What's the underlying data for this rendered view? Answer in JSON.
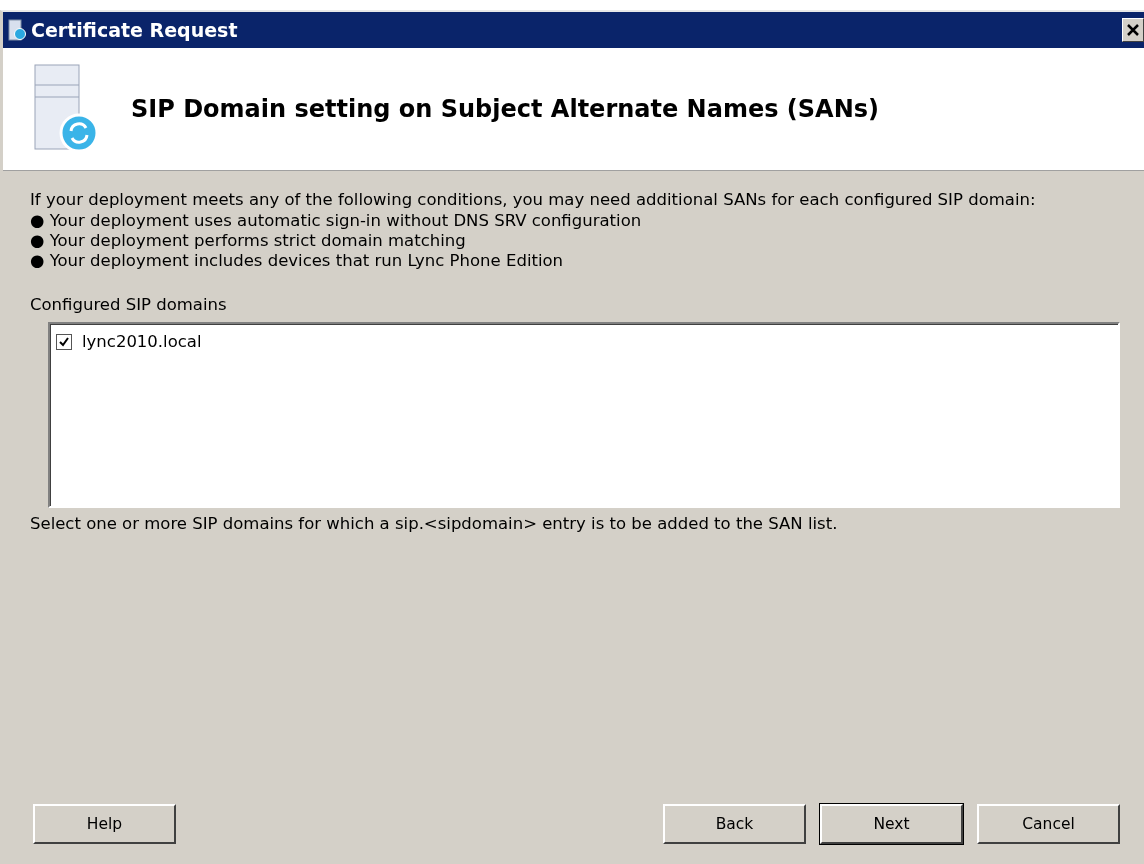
{
  "window": {
    "title": "Certificate Request"
  },
  "header": {
    "title": "SIP Domain setting on Subject Alternate Names (SANs)"
  },
  "intro": "If your deployment meets any of the following conditions, you may need additional SANs for each configured SIP domain:",
  "conditions": [
    "● Your deployment uses automatic sign-in without DNS SRV configuration",
    "● Your deployment performs strict domain matching",
    "● Your deployment includes devices that run Lync Phone Edition"
  ],
  "domains_label": "Configured SIP domains",
  "domains": [
    {
      "label": "lync2010.local",
      "checked": true
    }
  ],
  "hint": "Select one or more SIP domains for which a sip.<sipdomain> entry is to be added to the SAN list.",
  "help_button": "Help",
  "nav_buttons": [
    {
      "label": "Back",
      "default": false
    },
    {
      "label": "Next",
      "default": true
    },
    {
      "label": "Cancel",
      "default": false
    }
  ]
}
